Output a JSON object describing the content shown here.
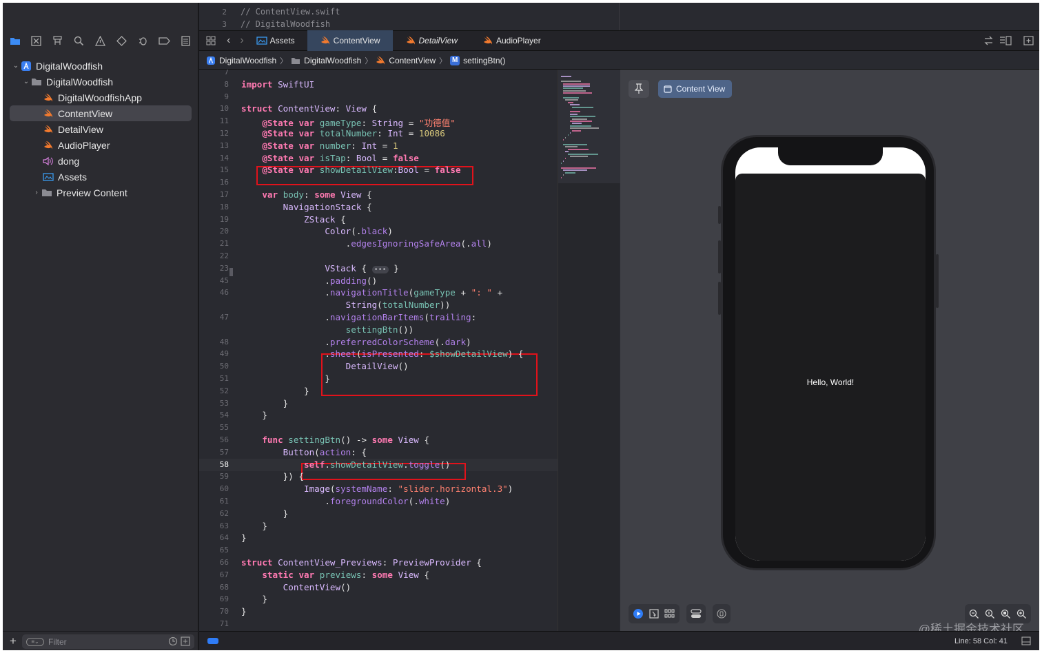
{
  "sidebar": {
    "navigator_icons": [
      "folder-icon",
      "source-control-icon",
      "hierarchy-icon",
      "search-icon",
      "warning-icon",
      "test-diamond-icon",
      "debug-icon",
      "breakpoint-icon",
      "report-icon"
    ],
    "tree": [
      {
        "label": "DigitalWoodfish",
        "kind": "project",
        "expanded": true
      },
      {
        "label": "DigitalWoodfish",
        "kind": "folder",
        "expanded": true
      },
      {
        "label": "DigitalWoodfishApp",
        "kind": "swift"
      },
      {
        "label": "ContentView",
        "kind": "swift",
        "selected": true
      },
      {
        "label": "DetailView",
        "kind": "swift"
      },
      {
        "label": "AudioPlayer",
        "kind": "swift"
      },
      {
        "label": "dong",
        "kind": "audio"
      },
      {
        "label": "Assets",
        "kind": "assets"
      },
      {
        "label": "Preview Content",
        "kind": "folder",
        "expanded": false
      }
    ],
    "filter_placeholder": "Filter"
  },
  "top_peek": {
    "line_numbers": [
      "2",
      "3"
    ],
    "lines": [
      "//  ContentView.swift",
      "//  DigitalWoodfish"
    ]
  },
  "tabs": [
    {
      "label": "Assets",
      "icon": "assets-icon",
      "active": false,
      "italic": false
    },
    {
      "label": "ContentView",
      "icon": "swift-icon",
      "active": true,
      "italic": false
    },
    {
      "label": "DetailView",
      "icon": "swift-icon",
      "active": false,
      "italic": true
    },
    {
      "label": "AudioPlayer",
      "icon": "swift-icon",
      "active": false,
      "italic": false
    }
  ],
  "jumpbar": [
    {
      "label": "DigitalWoodfish",
      "icon": "project-icon"
    },
    {
      "label": "DigitalWoodfish",
      "icon": "folder-icon"
    },
    {
      "label": "ContentView",
      "icon": "swift-icon"
    },
    {
      "label": "settingBtn()",
      "icon": "method-icon",
      "badge": "M"
    }
  ],
  "editor": {
    "current_line": "58",
    "lines": [
      {
        "n": "7",
        "code": ""
      },
      {
        "n": "8",
        "code": "import SwiftUI"
      },
      {
        "n": "9",
        "code": ""
      },
      {
        "n": "10",
        "code": "struct ContentView: View {"
      },
      {
        "n": "11",
        "code": "    @State var gameType: String = \"功德值\""
      },
      {
        "n": "12",
        "code": "    @State var totalNumber: Int = 10086"
      },
      {
        "n": "13",
        "code": "    @State var number: Int = 1"
      },
      {
        "n": "14",
        "code": "    @State var isTap: Bool = false"
      },
      {
        "n": "15",
        "code": "    @State var showDetailView:Bool = false"
      },
      {
        "n": "16",
        "code": ""
      },
      {
        "n": "17",
        "code": "    var body: some View {"
      },
      {
        "n": "18",
        "code": "        NavigationStack {"
      },
      {
        "n": "19",
        "code": "            ZStack {"
      },
      {
        "n": "20",
        "code": "                Color(.black)"
      },
      {
        "n": "21",
        "code": "                    .edgesIgnoringSafeArea(.all)"
      },
      {
        "n": "22",
        "code": ""
      },
      {
        "n": "23",
        "code": "                VStack { ••• }"
      },
      {
        "n": "45",
        "code": "                .padding()"
      },
      {
        "n": "46",
        "code": "                .navigationTitle(gameType + \": \" +"
      },
      {
        "n": "",
        "code": "                    String(totalNumber))"
      },
      {
        "n": "47",
        "code": "                .navigationBarItems(trailing:"
      },
      {
        "n": "",
        "code": "                    settingBtn())"
      },
      {
        "n": "48",
        "code": "                .preferredColorScheme(.dark)"
      },
      {
        "n": "49",
        "code": "                .sheet(isPresented: $showDetailView) {"
      },
      {
        "n": "50",
        "code": "                    DetailView()"
      },
      {
        "n": "51",
        "code": "                }"
      },
      {
        "n": "52",
        "code": "            }"
      },
      {
        "n": "53",
        "code": "        }"
      },
      {
        "n": "54",
        "code": "    }"
      },
      {
        "n": "55",
        "code": ""
      },
      {
        "n": "56",
        "code": "    func settingBtn() -> some View {"
      },
      {
        "n": "57",
        "code": "        Button(action: {"
      },
      {
        "n": "58",
        "code": "            self.showDetailView.toggle()"
      },
      {
        "n": "59",
        "code": "        }) {"
      },
      {
        "n": "60",
        "code": "            Image(systemName: \"slider.horizontal.3\")"
      },
      {
        "n": "61",
        "code": "                .foregroundColor(.white)"
      },
      {
        "n": "62",
        "code": "        }"
      },
      {
        "n": "63",
        "code": "    }"
      },
      {
        "n": "64",
        "code": "}"
      },
      {
        "n": "65",
        "code": ""
      },
      {
        "n": "66",
        "code": "struct ContentView_Previews: PreviewProvider {"
      },
      {
        "n": "67",
        "code": "    static var previews: some View {"
      },
      {
        "n": "68",
        "code": "        ContentView()"
      },
      {
        "n": "69",
        "code": "    }"
      },
      {
        "n": "70",
        "code": "}"
      },
      {
        "n": "71",
        "code": ""
      }
    ]
  },
  "preview": {
    "content_view_button": "Content View",
    "hello_text": "Hello, World!",
    "watermark": "@稀土掘金技术社区"
  },
  "status": {
    "line_col": "Line: 58  Col: 41"
  },
  "colors": {
    "keyword": "#ff7ab2",
    "type": "#dabaff",
    "property": "#78c2b3",
    "string": "#ff8170",
    "number": "#d9c97c",
    "annotation_red": "#e1121b",
    "active_tab": "#36465e"
  }
}
